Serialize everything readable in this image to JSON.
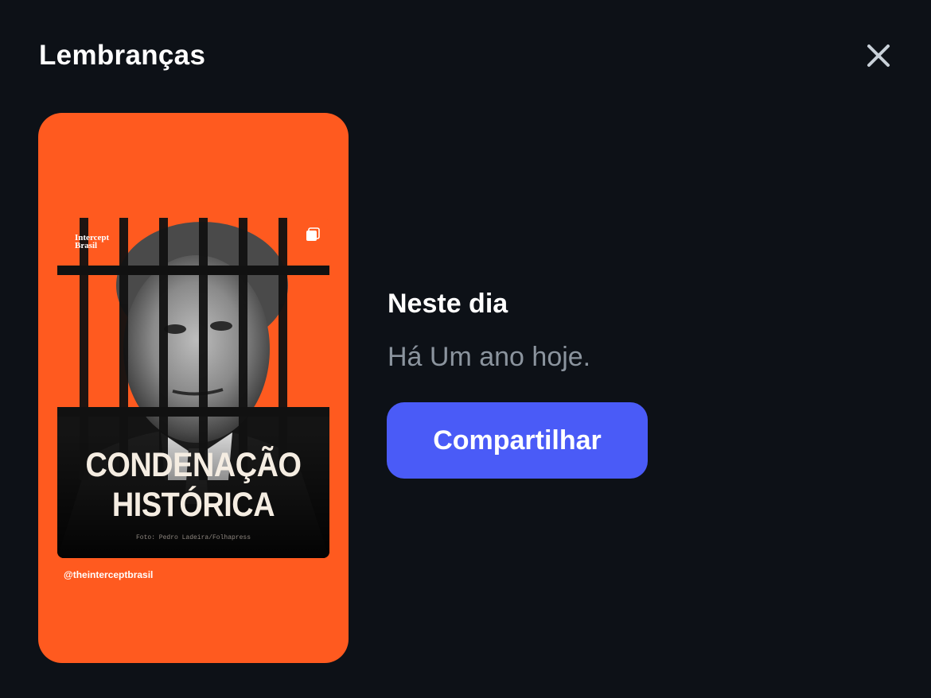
{
  "dialog": {
    "title": "Lembranças",
    "close_icon": "close-icon"
  },
  "story": {
    "brand_logo": "Intercept\nBrasil",
    "multi_image_icon": "multiple-images-icon",
    "headline_line1": "CONDENAÇÃO",
    "headline_line2": "HISTÓRICA",
    "photo_credit": "Foto: Pedro Ladeira/Folhapress",
    "handle": "@theinterceptbrasil",
    "background_color": "#ff5a1f"
  },
  "memory": {
    "heading": "Neste dia",
    "subtitle": "Há Um ano hoje.",
    "share_label": "Compartilhar"
  },
  "colors": {
    "background": "#0d1117",
    "accent": "#4a5bf7",
    "muted_text": "#8b949e"
  }
}
